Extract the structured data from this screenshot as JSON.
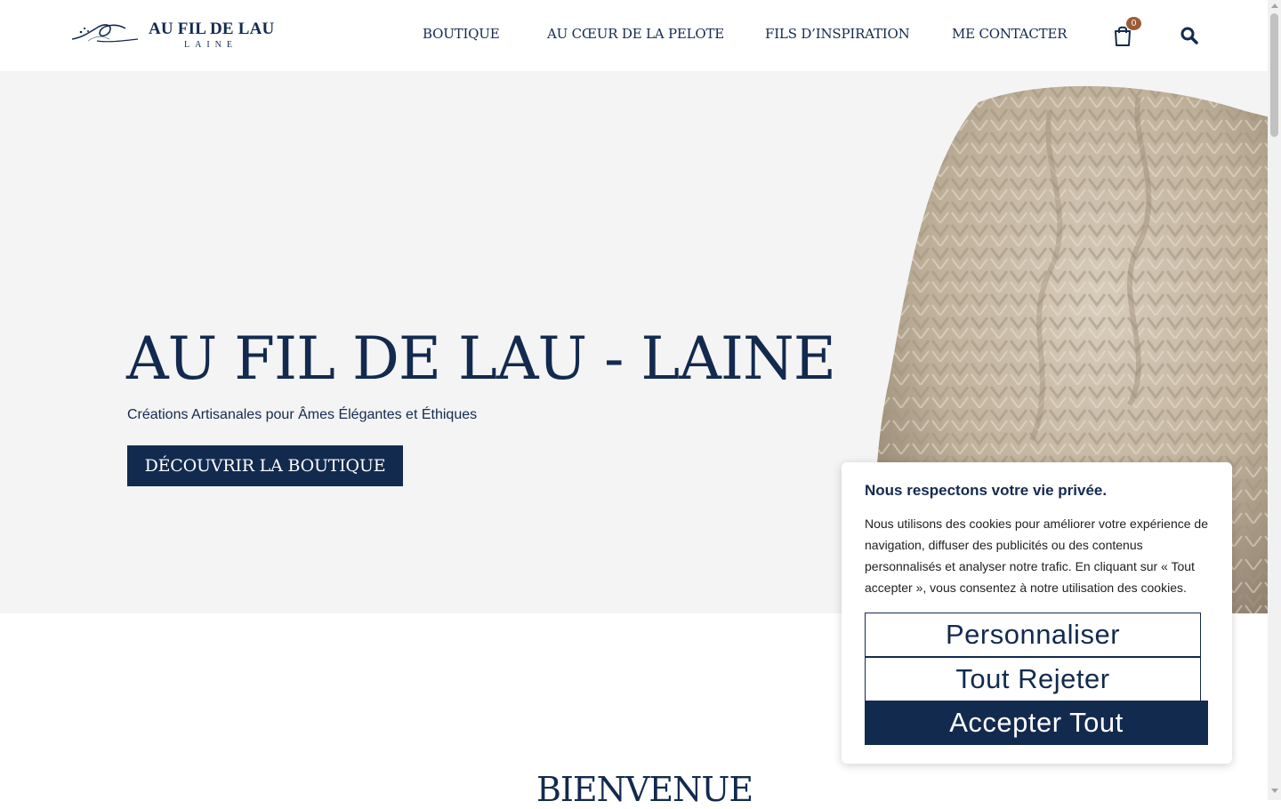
{
  "header": {
    "logo": {
      "main": "AU FIL DE LAU",
      "sub": "LAINE"
    },
    "nav": [
      "BOUTIQUE",
      "AU CŒUR DE LA PELOTE",
      "FILS D’INSPIRATION",
      "ME CONTACTER"
    ],
    "cart_count": "0",
    "icons": {
      "cart": "shopping-bag-icon",
      "search": "search-icon"
    }
  },
  "hero": {
    "title": "AU FIL DE LAU - LAINE",
    "subtitle": "Créations Artisanales pour Âmes Élégantes et Éthiques",
    "cta": "DÉCOUVRIR LA BOUTIQUE"
  },
  "welcome": {
    "heading": "BIENVENUE"
  },
  "cookie_banner": {
    "title": "Nous respectons votre vie privée.",
    "text": "Nous utilisons des cookies pour améliorer votre expérience de navigation, diffuser des publicités ou des contenus personnalisés et analyser notre trafic. En cliquant sur « Tout accepter », vous consentez à notre utilisation des cookies.",
    "buttons": {
      "customize": "Personnaliser",
      "reject": "Tout Rejeter",
      "accept": "Accepter Tout"
    }
  },
  "colors": {
    "brand_navy": "#132a4f",
    "badge_brown": "#9c5b36",
    "hero_bg": "#f4f4f4"
  }
}
